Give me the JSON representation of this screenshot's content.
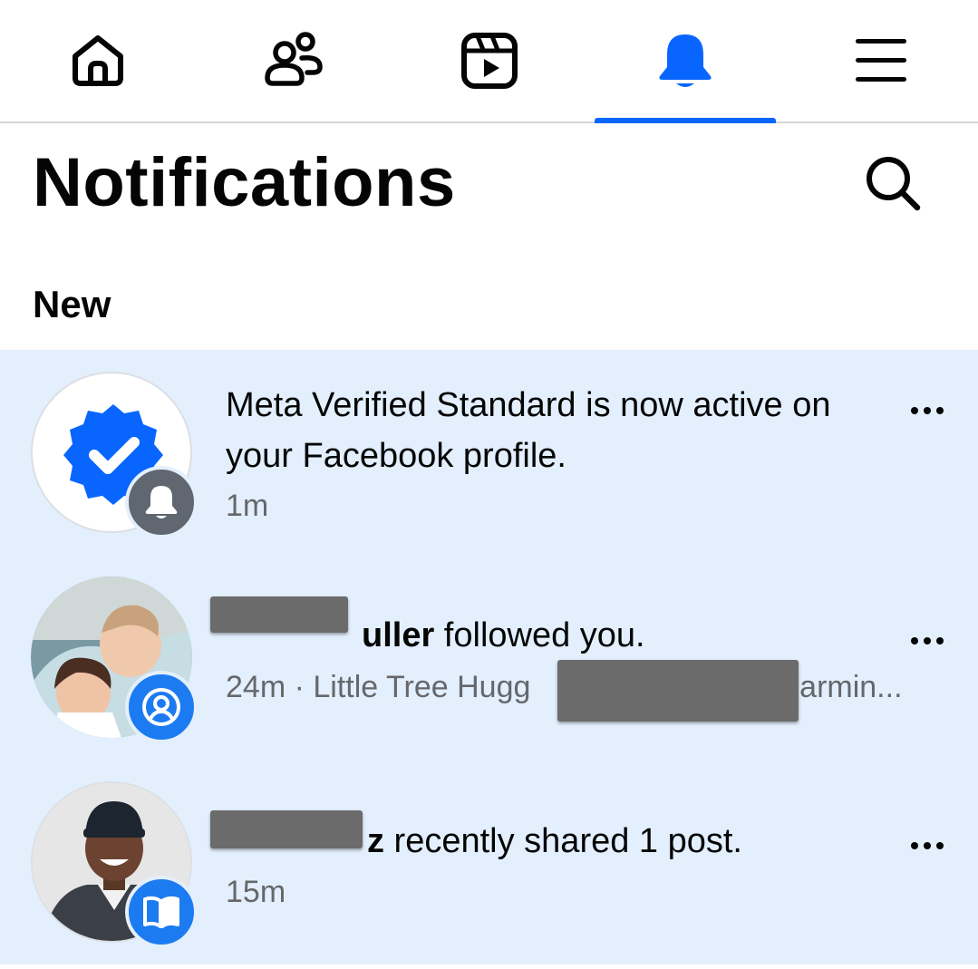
{
  "nav": {
    "tabs": [
      {
        "name": "home",
        "icon": "home-icon",
        "active": false
      },
      {
        "name": "friends",
        "icon": "friends-icon",
        "active": false
      },
      {
        "name": "video",
        "icon": "video-icon",
        "active": false
      },
      {
        "name": "notifications",
        "icon": "bell-icon",
        "active": true
      },
      {
        "name": "menu",
        "icon": "menu-icon",
        "active": false
      }
    ],
    "accent_color": "#0866ff"
  },
  "page": {
    "title": "Notifications",
    "search_icon": "search-icon"
  },
  "section": {
    "title": "New"
  },
  "notifications": [
    {
      "text": "Meta Verified Standard is now active on your Facebook profile.",
      "time": "1m",
      "avatar_icon": "verified-badge-icon",
      "badge_icon": "bell-icon"
    },
    {
      "name_visible": "uller",
      "text": " followed you.",
      "meta_prefix": "24m · Little Tree Hugg",
      "meta_suffix": "Farmin...",
      "badge_icon": "person-icon"
    },
    {
      "name_visible": "z",
      "text": " recently shared 1 post.",
      "time": "15m",
      "badge_icon": "book-icon"
    }
  ],
  "colors": {
    "highlight_bg": "#e3effd",
    "badge_blue": "#1d7bf2",
    "badge_gray": "#606770",
    "meta_text": "#65676b"
  }
}
